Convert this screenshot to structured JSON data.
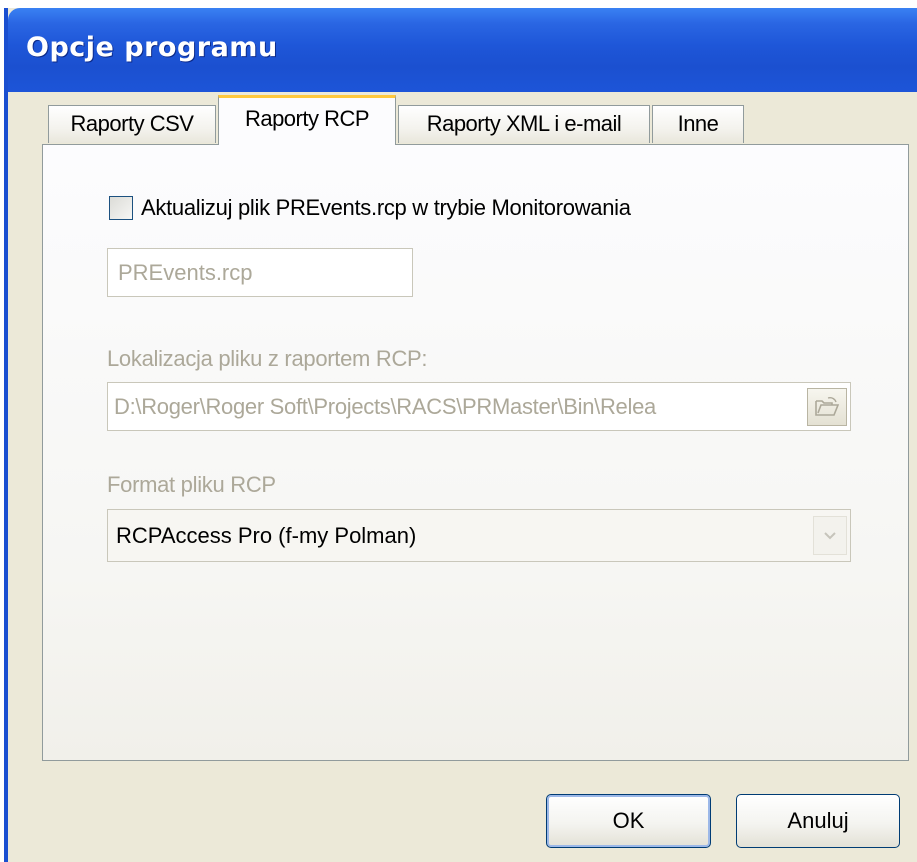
{
  "window": {
    "title": "Opcje programu"
  },
  "tabs": [
    {
      "label": "Raporty CSV",
      "active": false
    },
    {
      "label": "Raporty RCP",
      "active": true
    },
    {
      "label": "Raporty XML i e-mail",
      "active": false
    },
    {
      "label": "Inne",
      "active": false
    }
  ],
  "rcp": {
    "update_checkbox_label": "Aktualizuj plik PREvents.rcp w trybie Monitorowania",
    "update_checkbox_checked": false,
    "filename_value": "PREvents.rcp",
    "location_label": "Lokalizacja pliku z raportem RCP:",
    "location_value": "D:\\Roger\\Roger Soft\\Projects\\RACS\\PRMaster\\Bin\\Relea",
    "browse_icon": "folder-open-icon",
    "format_label": "Format pliku RCP",
    "format_value": "RCPAccess Pro (f-my Polman)"
  },
  "buttons": {
    "ok_label": "OK",
    "cancel_label": "Anuluj"
  },
  "colors": {
    "titlebar": "#1e56d8",
    "dialog_bg": "#ece9d8",
    "active_tab_accent": "#ffc83c",
    "disabled_text": "#aca899"
  }
}
